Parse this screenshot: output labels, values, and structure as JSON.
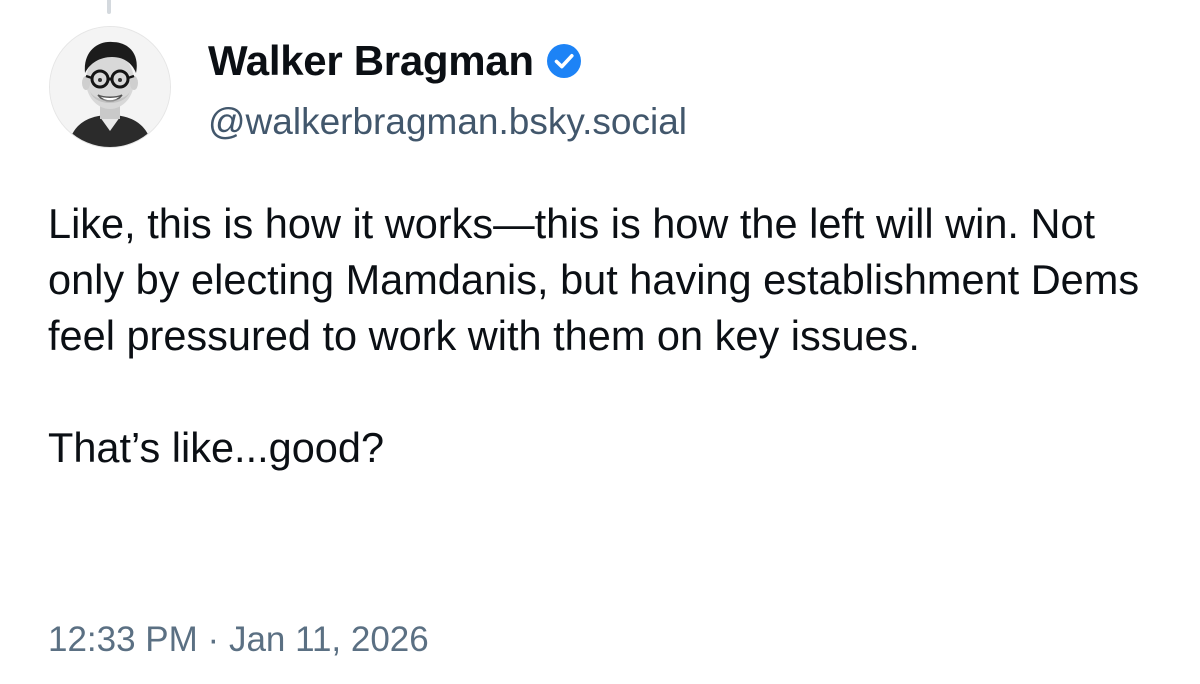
{
  "author": {
    "display_name": "Walker Bragman",
    "handle": "@walkerbragman.bsky.social",
    "verified": true,
    "verified_color": "#1d83f6"
  },
  "post": {
    "paragraph_1": "Like, this is how it works—this is how the left will win. Not only by electing Mamdanis, but having establishment Dems feel pressured to work with them on key issues.",
    "paragraph_2": "That’s like...good?"
  },
  "timestamp": {
    "time": "12:33 PM",
    "separator": "·",
    "date": "Jan 11, 2026"
  },
  "icons": {
    "verified_badge": "verified-check-icon",
    "avatar": "avatar-photo"
  }
}
